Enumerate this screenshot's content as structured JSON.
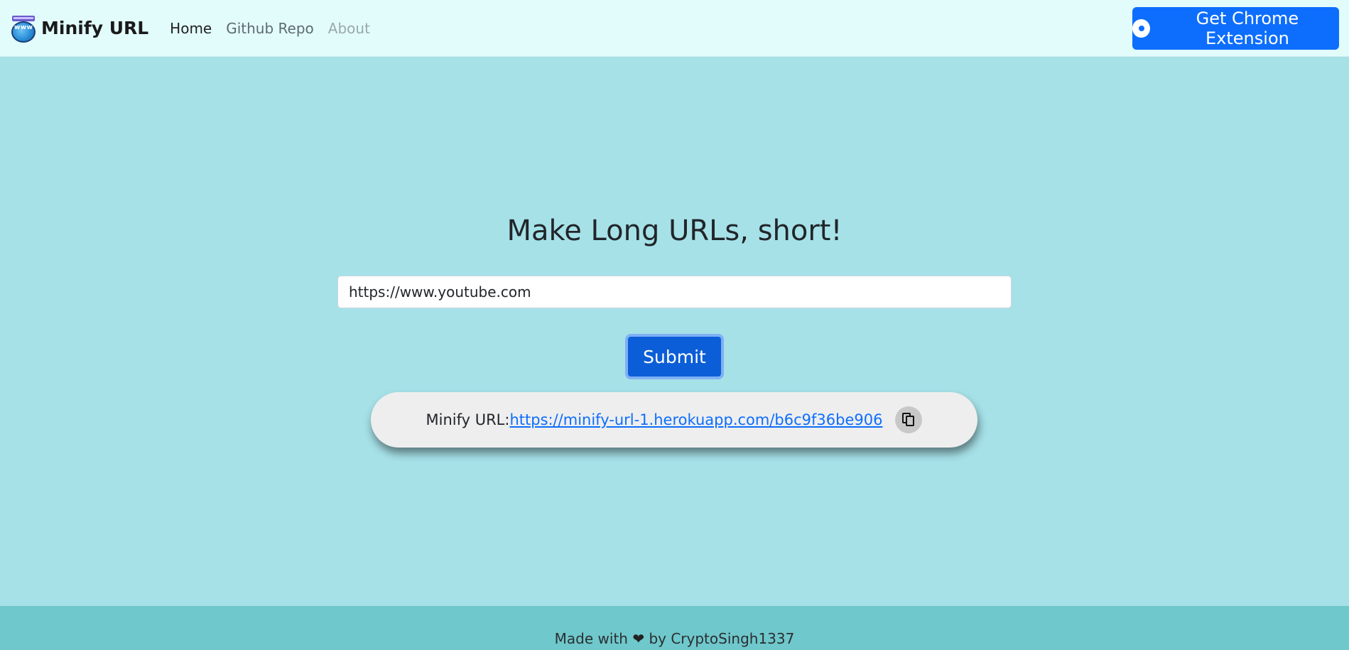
{
  "navbar": {
    "brand_name": "Minify URL",
    "logo_text": "www",
    "links": [
      {
        "label": "Home",
        "state": "active"
      },
      {
        "label": "Github Repo",
        "state": "normal"
      },
      {
        "label": "About",
        "state": "muted"
      }
    ],
    "extension_button": "Get Chrome Extension",
    "extension_icon": "chrome-icon"
  },
  "main": {
    "heading": "Make Long URLs, short!",
    "url_input_value": "https://www.youtube.com",
    "submit_label": "Submit",
    "result": {
      "label": "Minify URL:",
      "link": "https://minify-url-1.herokuapp.com/b6c9f36be906",
      "copy_icon": "copy-icon"
    }
  },
  "footer": {
    "prefix": "Made with",
    "heart": "❤",
    "suffix": "by CryptoSingh1337"
  },
  "colors": {
    "navbar_bg": "#e2fcfc",
    "page_bg": "#a6e1e8",
    "primary": "#0d6efd",
    "footer_bg": "#6fc8cb",
    "result_bg": "#eeeeee"
  }
}
